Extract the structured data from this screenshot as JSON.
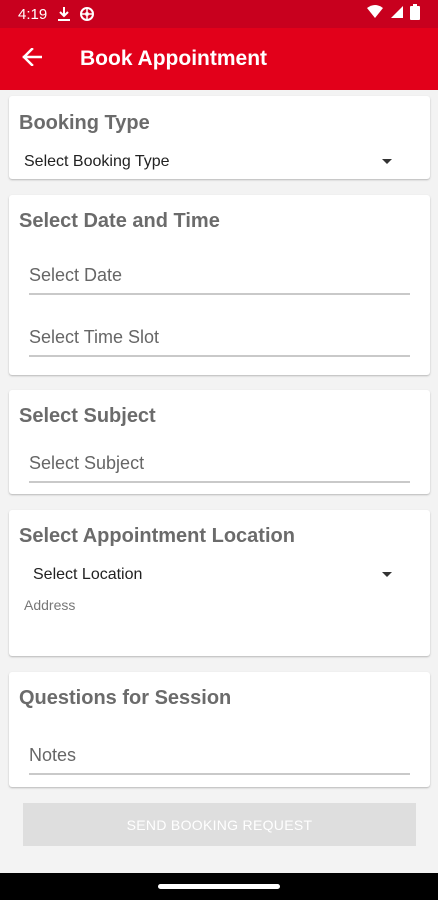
{
  "status_bar": {
    "time": "4:19",
    "left_icons": [
      "download-icon",
      "vpn-icon"
    ],
    "right_icons": [
      "wifi-icon",
      "cell-signal-icon",
      "battery-icon"
    ]
  },
  "app_bar": {
    "title": "Book Appointment",
    "back_icon": "arrow-back-icon",
    "color": "#e2001a"
  },
  "booking_type": {
    "title": "Booking Type",
    "dropdown_value": "Select Booking Type"
  },
  "date_time": {
    "title": "Select Date and Time",
    "date_placeholder": "Select Date",
    "time_placeholder": "Select Time Slot"
  },
  "subject": {
    "title": "Select Subject",
    "placeholder": "Select Subject"
  },
  "location": {
    "title": "Select Appointment Location",
    "dropdown_value": "Select Location",
    "address_label": "Address"
  },
  "questions": {
    "title": "Questions for Session",
    "notes_placeholder": "Notes"
  },
  "send_button": {
    "label": "SEND BOOKING REQUEST",
    "enabled": false
  }
}
